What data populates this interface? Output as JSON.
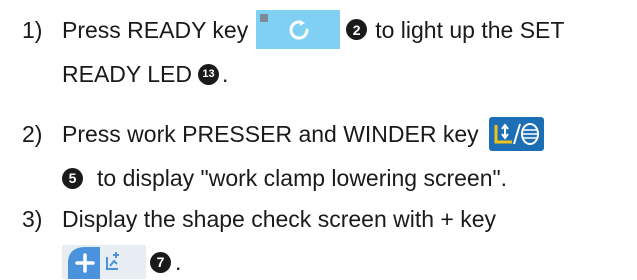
{
  "steps": [
    {
      "number": "1)",
      "line1_before": "Press READY key",
      "marker1": "2",
      "line1_after": "to light up the SET",
      "line2": "READY LED",
      "marker2": "13",
      "line2_end": "."
    },
    {
      "number": "2)",
      "line1": "Press work PRESSER and WINDER key",
      "marker": "5",
      "line2": "to display \"work clamp lowering screen\"."
    },
    {
      "number": "3)",
      "line1": "Display the shape check screen with + key",
      "marker": "7",
      "line2_end": "."
    }
  ],
  "keys": {
    "ready": {
      "icon": "refresh-circle-icon",
      "color": "#7fd0f2"
    },
    "presser": {
      "icon": "presser-winder-icon",
      "color": "#1d6fb5",
      "accent": "#f0c21a"
    },
    "plus": {
      "icon": "plus-icon",
      "color": "#4a93dc",
      "panel": "#e7edf3"
    }
  }
}
